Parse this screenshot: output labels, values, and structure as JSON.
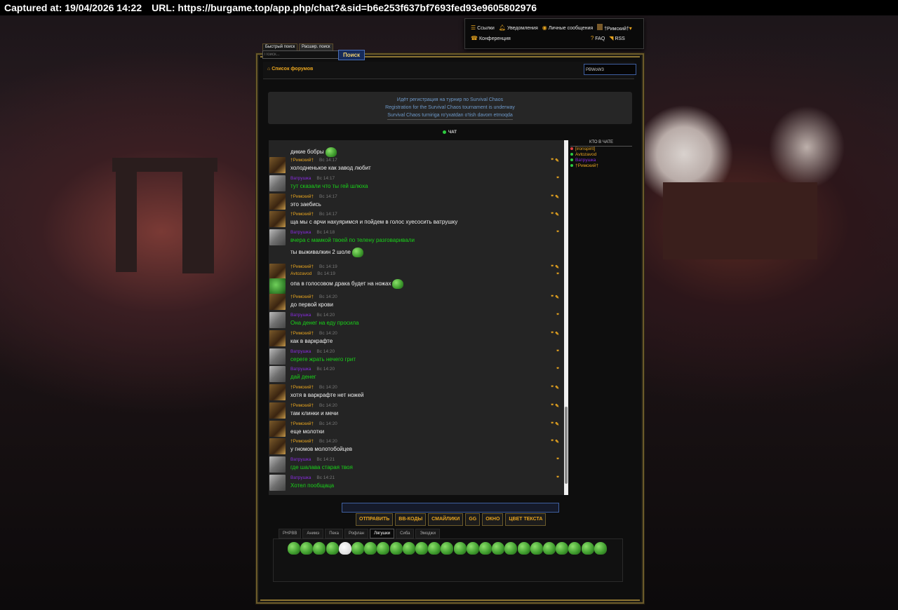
{
  "capture": {
    "captured_at": "Captured at: 19/04/2026 14:22",
    "url": "URL: https://burgame.top/app.php/chat?&sid=b6e253f637bf7693fed93e9605802976"
  },
  "usernav": {
    "links": "Ссылки",
    "notifications": "Уведомления",
    "messages": "Личные сообщения",
    "username": "†Римский†",
    "conference": "Конференция",
    "faq": "FAQ",
    "rss": "RSS"
  },
  "search": {
    "quick_tab": "Быстрый поиск",
    "advanced_tab": "Расшир. поиск",
    "placeholder": "Поиск...",
    "button": "Поиск"
  },
  "nav": {
    "forum_list": "Список форумов",
    "forum_select": "PBWoW3"
  },
  "announce": {
    "line1": "Идёт регистрация на турнир по Survival Chaos",
    "line2": "Registration for the Survival Chaos tournament is underway",
    "line3": "Survival Chaos turniriga ro'yxatdan o'tish davom etmoqda"
  },
  "chat": {
    "label": "ЧАТ",
    "first_text": "дикие бобры",
    "messages": [
      {
        "user": "†Римский†",
        "time": "Вс 14:17",
        "text": "холодненькое как завод любит"
      },
      {
        "user": "Ватрушка",
        "time": "Вс 14:17",
        "text": "тут сказали что ты гей шлюха"
      },
      {
        "user": "†Римский†",
        "time": "Вс 14:17",
        "text": "это заебись"
      },
      {
        "user": "†Римский†",
        "time": "Вс 14:17",
        "text": "ща мы с арчи нахуяримся и пойдем в голос хуесосить ватрушку"
      },
      {
        "user": "Ватрушка",
        "time": "Вс 14:18",
        "text": "вчера с мамкой твоей по телену разговаривали"
      },
      {
        "user": "†Римский†",
        "time": "Вс 14:19",
        "text": "ты выживалкин 2 шоле"
      },
      {
        "user": "Avtozavod",
        "time": "Вс 14:19",
        "text": "опа в голосовом драка будет на ножах"
      },
      {
        "user": "†Римский†",
        "time": "Вс 14:20",
        "text": "до первой крови"
      },
      {
        "user": "Ватрушка",
        "time": "Вс 14:20",
        "text": "Она денег на еду просила"
      },
      {
        "user": "†Римский†",
        "time": "Вс 14:20",
        "text": "как в варкрафте"
      },
      {
        "user": "Ватрушка",
        "time": "Вс 14:20",
        "text": "сереге жрать нечего грит"
      },
      {
        "user": "Ватрушка",
        "time": "Вс 14:20",
        "text": "дай денег"
      },
      {
        "user": "†Римский†",
        "time": "Вс 14:20",
        "text": "хотя в варкрафте нет ножей"
      },
      {
        "user": "†Римский†",
        "time": "Вс 14:20",
        "text": "там клинки и мечи"
      },
      {
        "user": "†Римский†",
        "time": "Вс 14:20",
        "text": "еще молотки"
      },
      {
        "user": "†Римский†",
        "time": "Вс 14:20",
        "text": "у гномов молотобойцев"
      },
      {
        "user": "Ватрушка",
        "time": "Вс 14:21",
        "text": "где шалава старая твоя"
      },
      {
        "user": "Ватрушка",
        "time": "Вс 14:21",
        "text": "Хотел пообщаца"
      }
    ]
  },
  "who": {
    "header": "КТО В ЧАТЕ",
    "users": [
      "[ironspirit]",
      "Avtozavod",
      "Ватрушка",
      "†Римский†"
    ]
  },
  "buttons": [
    "ОТПРАВИТЬ",
    "BB-КОДЫ",
    "СМАЙЛИКИ",
    "GG",
    "ОКНО",
    "ЦВЕТ ТЕКСТА"
  ],
  "smiley_tabs": [
    "PHPBB",
    "Анимэ",
    "Пека",
    "Рофлан",
    "Лягушки",
    "Сиба",
    "Эмоджи"
  ],
  "active_smiley_tab": "Лягушки",
  "colors": {
    "accent": "#e7a41f",
    "vatrushka_name": "#8a2be2",
    "vatrushka_text": "#19d219",
    "link_blue": "#6d98c8"
  }
}
